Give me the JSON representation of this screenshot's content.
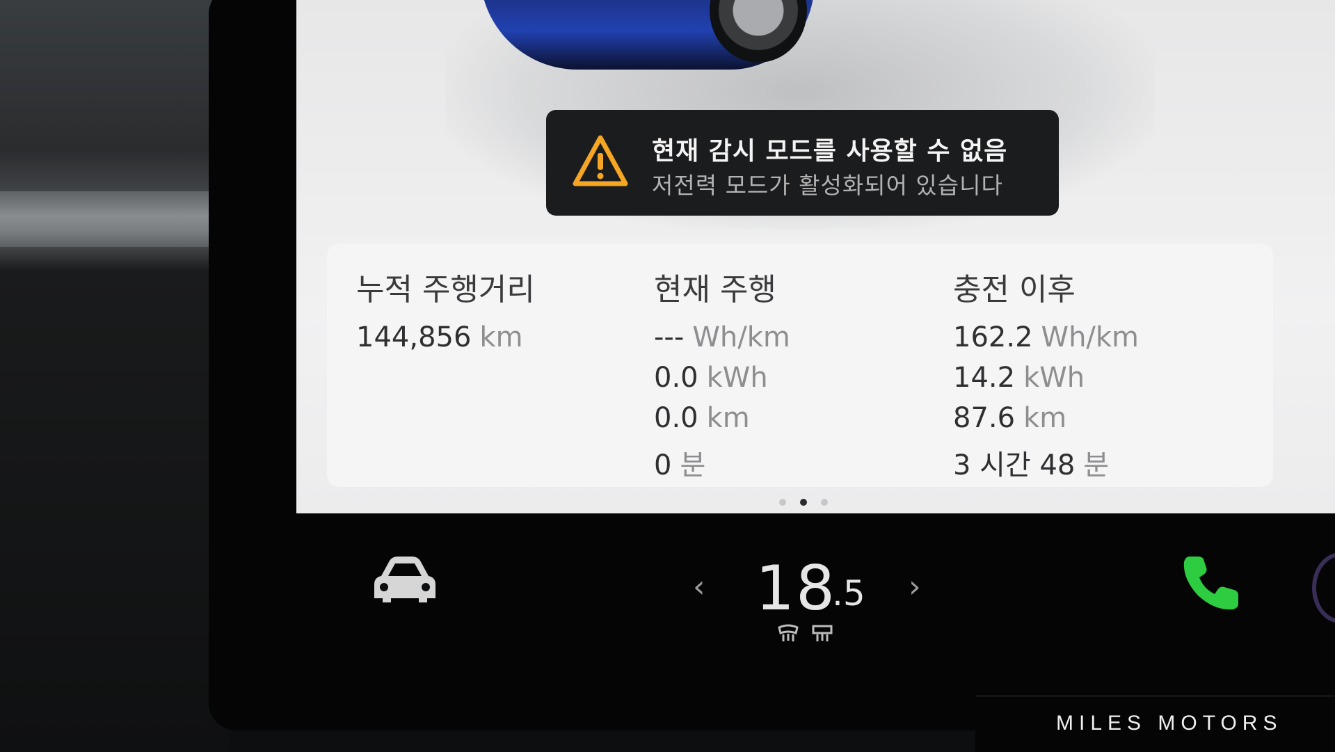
{
  "alert": {
    "icon": "warning-icon",
    "title": "현재 감시 모드를 사용할 수 없음",
    "subtitle": "저전력 모드가 활성화되어 있습니다",
    "accent_color": "#f5a623"
  },
  "stats": {
    "odometer": {
      "heading": "누적 주행거리",
      "rows": [
        {
          "value": "144,856",
          "unit": "km"
        }
      ]
    },
    "current_trip": {
      "heading": "현재 주행",
      "rows": [
        {
          "value": "---",
          "unit": "Wh/km"
        },
        {
          "value": "0.0",
          "unit": "kWh"
        },
        {
          "value": "0.0",
          "unit": "km"
        },
        {
          "value": "0",
          "unit": "분"
        }
      ]
    },
    "since_charge": {
      "heading": "충전 이후",
      "rows": [
        {
          "value": "162.2",
          "unit": "Wh/km"
        },
        {
          "value": "14.2",
          "unit": "kWh"
        },
        {
          "value": "87.6",
          "unit": "km"
        },
        {
          "value": "3 시간 48",
          "unit": "분"
        }
      ]
    }
  },
  "pager": {
    "total": 3,
    "active_index": 1
  },
  "climate": {
    "temp_int": "18",
    "temp_dec": ".5",
    "decrease": "‹",
    "increase": "›",
    "seat_heater_icons": "seat-heater-left-icon, seat-heater-right-icon"
  },
  "dock": {
    "car_icon": "car-icon",
    "phone_icon": "phone-icon",
    "phone_color": "#2ecc40"
  },
  "watermark": {
    "text": "MILES MOTORS"
  }
}
